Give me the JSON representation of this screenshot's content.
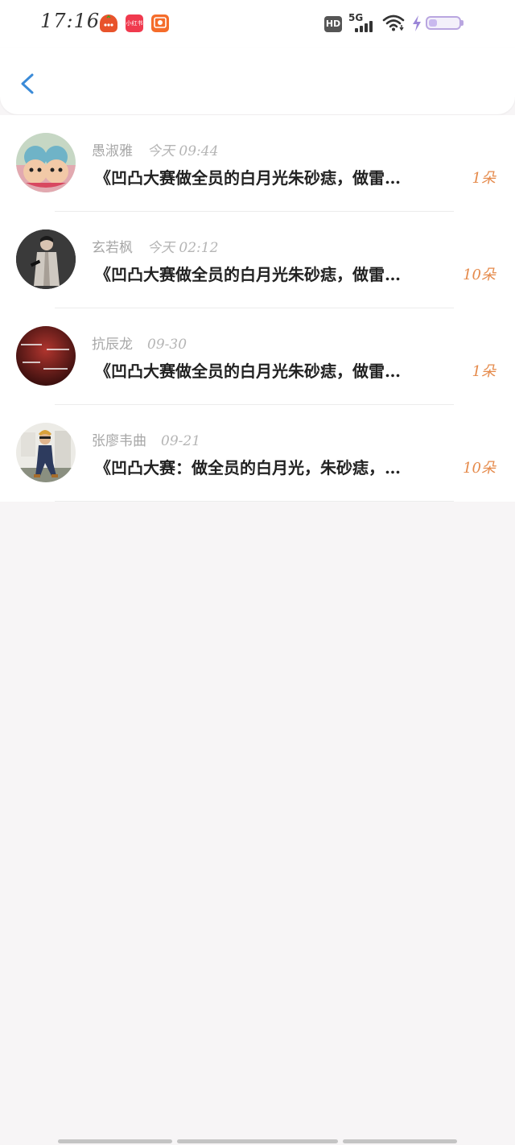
{
  "status_bar": {
    "time": "17:16",
    "app_icons": [
      {
        "name": "taobao-icon",
        "color": "#e8532b",
        "label": ""
      },
      {
        "name": "xiaohongshu-icon",
        "color": "#f03a4e",
        "label": "小红书"
      },
      {
        "name": "pinduoduo-icon",
        "color": "#f56c2a",
        "label": ""
      }
    ],
    "hd": "HD",
    "network": "5G",
    "battery_level": 0.2
  },
  "colors": {
    "accent": "#3b8bd8",
    "count": "#e58a4b",
    "name": "#a7a7a7"
  },
  "items": [
    {
      "name": "愚淑雅",
      "date": "今天 09:44",
      "snippet": "《凹凸大赛做全员的白月光朱砂痣，做雷…",
      "count": "1朵"
    },
    {
      "name": "玄若枫",
      "date": "今天 02:12",
      "snippet": "《凹凸大赛做全员的白月光朱砂痣，做雷…",
      "count": "10朵"
    },
    {
      "name": "抗辰龙",
      "date": "09-30",
      "snippet": "《凹凸大赛做全员的白月光朱砂痣，做雷…",
      "count": "1朵"
    },
    {
      "name": "张廖韦曲",
      "date": "09-21",
      "snippet": "《凹凸大赛：做全员的白月光，朱砂痣，…",
      "count": "10朵"
    }
  ]
}
